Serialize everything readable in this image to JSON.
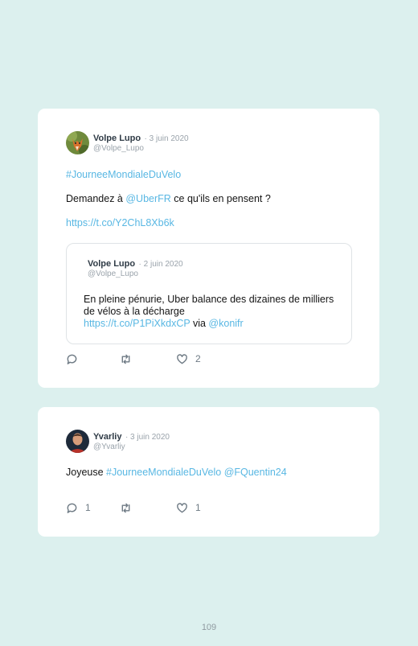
{
  "tweets": [
    {
      "author": "Volpe Lupo",
      "date": "3 juin 2020",
      "handle": "@Volpe_Lupo",
      "hashtag": "#JourneeMondialeDuVelo",
      "text_before": "Demandez à ",
      "mention": "@UberFR",
      "text_after": " ce qu'ils en pensent ?",
      "url": "https://t.co/Y2ChL8Xb6k",
      "quoted": {
        "author": "Volpe Lupo",
        "date": "2 juin 2020",
        "handle": "@Volpe_Lupo",
        "text": "En pleine pénurie, Uber balance des dizaines de milliers de vélos à la décharge",
        "url": "https://t.co/P1PiXkdxCP",
        "via_text": " via ",
        "via_mention": "@konifr"
      },
      "reply_count": "",
      "retweet_count": "",
      "like_count": "2"
    },
    {
      "author": "Yvarliy",
      "date": "3 juin 2020",
      "handle": "@Yvarliy",
      "text_before": "Joyeuse ",
      "hashtag": "#JourneeMondialeDuVelo",
      "mention": "@FQuentin24",
      "reply_count": "1",
      "retweet_count": "",
      "like_count": "1"
    }
  ],
  "page_number": "109",
  "colors": {
    "background": "#dcf0ee",
    "card": "#ffffff",
    "link": "#58b7e3",
    "icon": "#6e7a84"
  }
}
